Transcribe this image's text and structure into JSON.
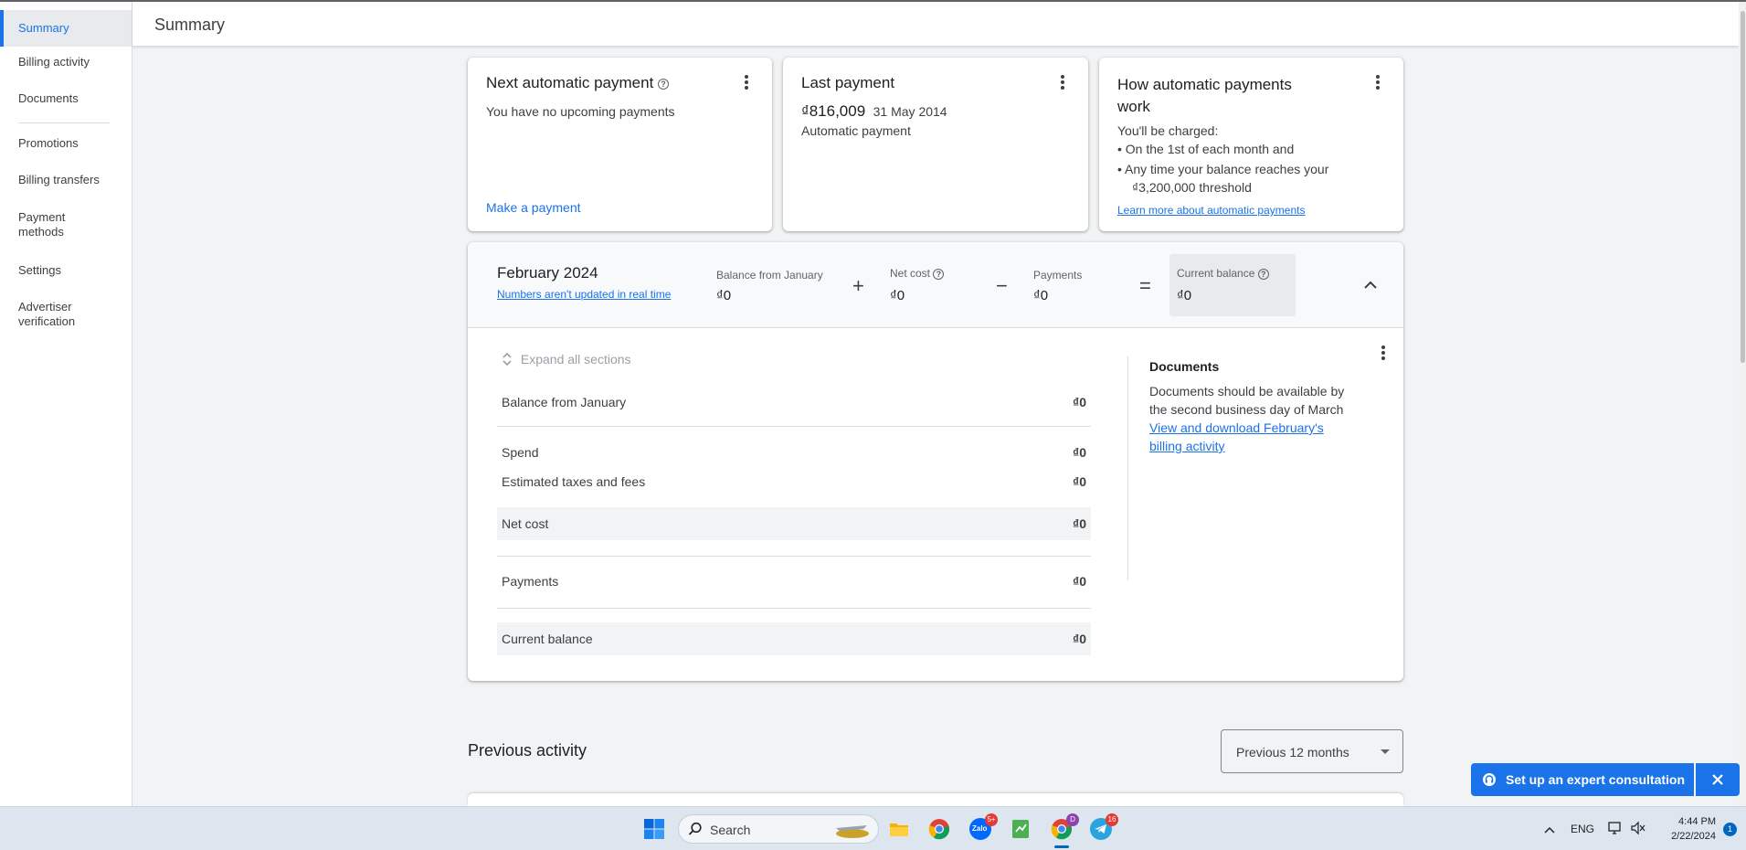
{
  "sidebar": {
    "items": [
      {
        "label": "Summary",
        "active": true
      },
      {
        "label": "Billing activity"
      },
      {
        "label": "Documents"
      },
      {
        "label": "Promotions"
      },
      {
        "label": "Billing transfers"
      },
      {
        "label": "Payment methods"
      },
      {
        "label": "Settings"
      },
      {
        "label": "Advertiser verification"
      }
    ]
  },
  "header": {
    "title": "Summary"
  },
  "cards": {
    "next_payment": {
      "title": "Next automatic payment",
      "text": "You have no upcoming payments",
      "action": "Make a payment"
    },
    "last_payment": {
      "title": "Last payment",
      "amount": "₫816,009",
      "date": "31 May 2014",
      "type": "Automatic payment"
    },
    "how_auto": {
      "title_line1": "How automatic payments",
      "title_line2": "work",
      "intro": "You'll be charged:",
      "bullet1": "On the 1st of each month and",
      "bullet2_line1": "Any time your balance reaches your",
      "bullet2_line2": "₫3,200,000 threshold",
      "link": "Learn more about automatic payments"
    }
  },
  "month": {
    "title": "February 2024",
    "note": "Numbers aren't updated in real time",
    "balance_label": "Balance from January",
    "balance_value": "₫0",
    "plus": "+",
    "netcost_label": "Net cost",
    "netcost_value": "₫0",
    "minus": "−",
    "payments_label": "Payments",
    "payments_value": "₫0",
    "equals": "=",
    "current_label": "Current balance",
    "current_value": "₫0",
    "expand_label": "Expand all sections",
    "rows": {
      "balance": {
        "label": "Balance from January",
        "value": "₫0"
      },
      "spend": {
        "label": "Spend",
        "value": "₫0"
      },
      "taxes": {
        "label": "Estimated taxes and fees",
        "value": "₫0"
      },
      "netcost": {
        "label": "Net cost",
        "value": "₫0"
      },
      "payments": {
        "label": "Payments",
        "value": "₫0"
      },
      "current": {
        "label": "Current balance",
        "value": "₫0"
      }
    },
    "documents": {
      "title": "Documents",
      "text_line1": "Documents should be available by",
      "text_line2": "the second business day of March",
      "link_line1": "View and download February's",
      "link_line2": "billing activity"
    }
  },
  "previous": {
    "title": "Previous activity",
    "range": "Previous 12 months"
  },
  "consult": {
    "label": "Set up an expert consultation"
  },
  "taskbar": {
    "search": "Search",
    "badges": {
      "zalo": "5+",
      "chrome_profile": "D",
      "telegram": "16"
    },
    "lang": "ENG",
    "time": "4:44 PM",
    "date": "2/22/2024",
    "notifications": "1"
  },
  "colors": {
    "accent": "#1a73e8",
    "taskbar": "#dde6ef"
  }
}
